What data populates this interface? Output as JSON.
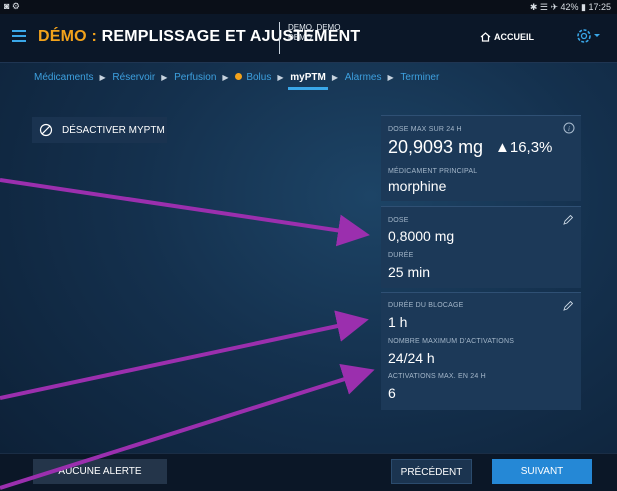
{
  "status_bar": {
    "left": "◙ ⚙",
    "right": "✱ ☰ ✈ 42% ▮ 17:25"
  },
  "header": {
    "mode": "DÉMO",
    "separator": " : ",
    "title": "REMPLISSAGE ET AJUSTEMENT",
    "patient_line1": "DEMO, DEMO",
    "patient_line2": "DEMO",
    "home_label": "ACCUEIL"
  },
  "breadcrumb": [
    {
      "label": "Médicaments"
    },
    {
      "label": "Réservoir"
    },
    {
      "label": "Perfusion"
    },
    {
      "label": "Bolus"
    },
    {
      "label": "myPTM"
    },
    {
      "label": "Alarmes"
    },
    {
      "label": "Terminer"
    }
  ],
  "disable_button": {
    "label": "DÉSACTIVER MYPTM"
  },
  "card_dose_max": {
    "label": "DOSE MAX SUR 24 H",
    "value": "20,9093 mg",
    "change": "▲16,3%",
    "drug_label": "MÉDICAMENT PRINCIPAL",
    "drug_value": "morphine"
  },
  "card_dose": {
    "dose_label": "DOSE",
    "dose_value": "0,8000 mg",
    "duration_label": "DURÉE",
    "duration_value": "25 min"
  },
  "card_lockout": {
    "lockout_label": "DURÉE DU BLOCAGE",
    "lockout_value": "1 h",
    "max_activations_label": "NOMBRE MAXIMUM D'ACTIVATIONS",
    "max_activations_value": "24/24 h",
    "max_24h_label": "ACTIVATIONS MAX. EN 24 H",
    "max_24h_value": "6"
  },
  "footer": {
    "alert_label": "AUCUNE ALERTE",
    "prev_label": "PRÉCÉDENT",
    "next_label": "SUIVANT"
  },
  "colors": {
    "accent_blue": "#3aa7e8",
    "mode_orange": "#f2a21b",
    "annotation_arrow": "#9b2fae",
    "next_button": "#2588d6"
  }
}
